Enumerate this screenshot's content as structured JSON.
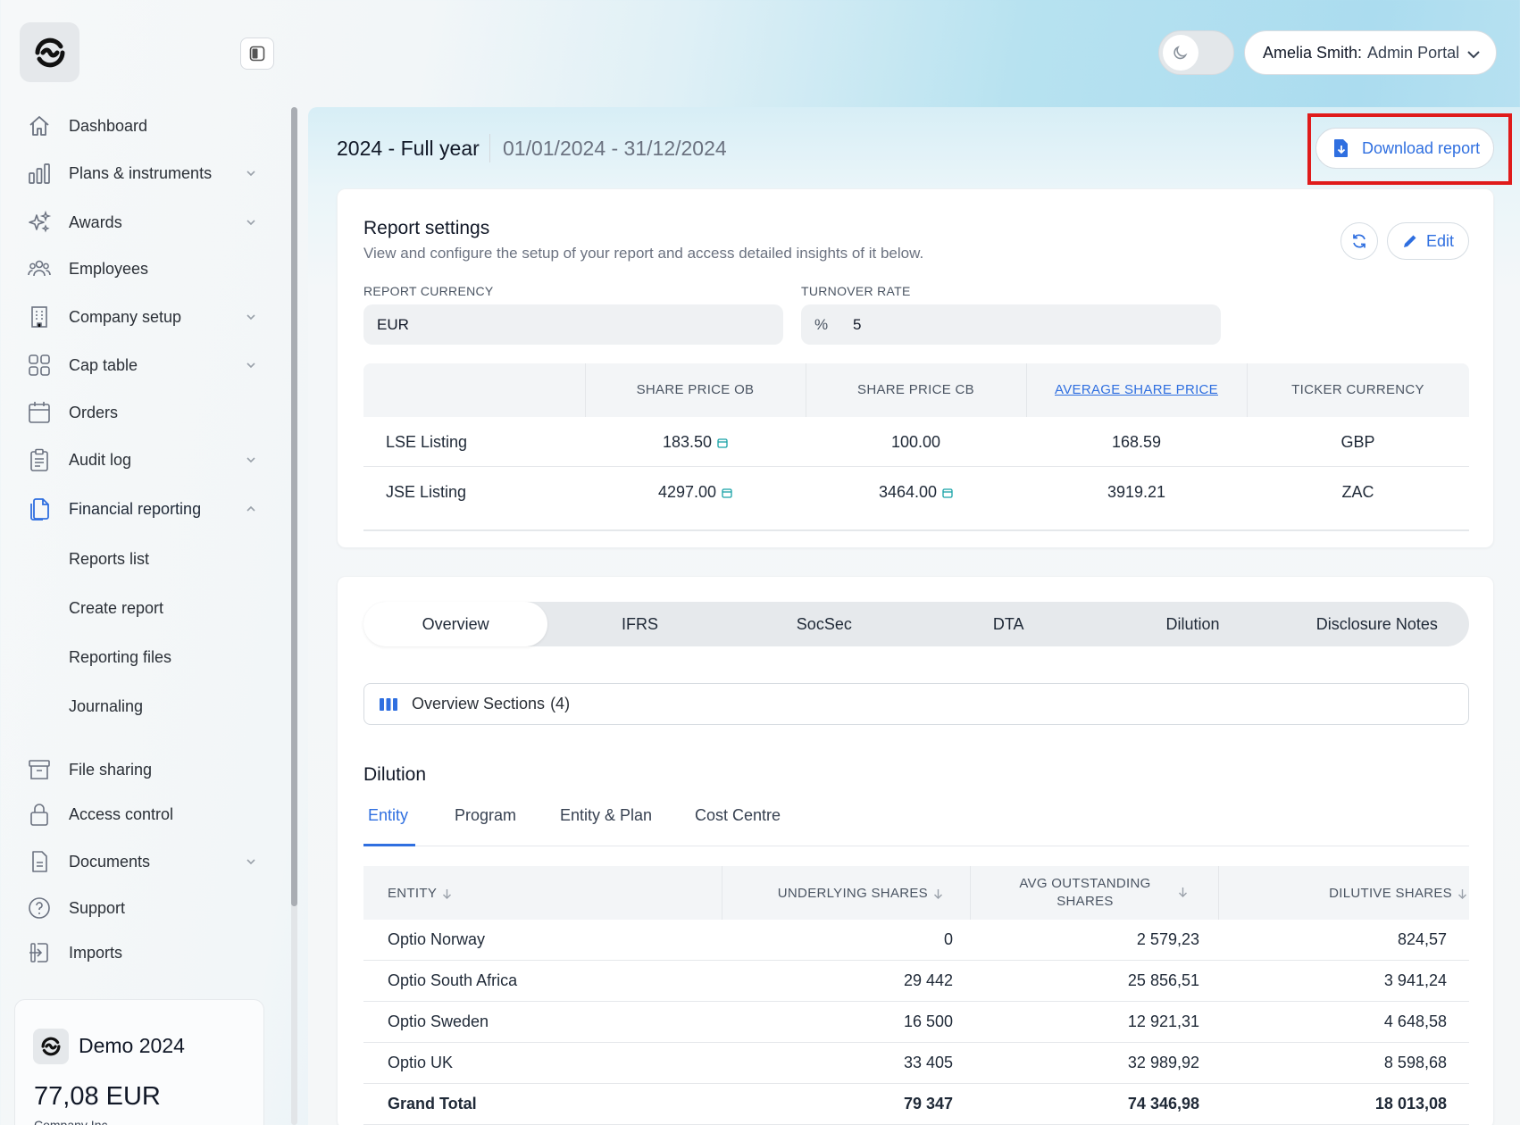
{
  "sidebar": {
    "items": [
      {
        "label": "Dashboard",
        "icon": "home-icon"
      },
      {
        "label": "Plans & instruments",
        "icon": "bar-chart-icon",
        "expandable": true
      },
      {
        "label": "Awards",
        "icon": "sparkles-icon",
        "expandable": true
      },
      {
        "label": "Employees",
        "icon": "users-icon"
      },
      {
        "label": "Company setup",
        "icon": "building-icon",
        "expandable": true
      },
      {
        "label": "Cap table",
        "icon": "grid-icon",
        "expandable": true
      },
      {
        "label": "Orders",
        "icon": "calendar-icon"
      },
      {
        "label": "Audit log",
        "icon": "clipboard-icon",
        "expandable": true
      },
      {
        "label": "Financial reporting",
        "icon": "files-icon",
        "expandable": true,
        "expanded": true,
        "active": true
      },
      {
        "label": "File sharing",
        "icon": "archive-icon"
      },
      {
        "label": "Access control",
        "icon": "lock-icon"
      },
      {
        "label": "Documents",
        "icon": "document-icon",
        "expandable": true
      },
      {
        "label": "Support",
        "icon": "help-icon"
      },
      {
        "label": "Imports",
        "icon": "import-icon"
      }
    ],
    "sub_items": [
      "Reports list",
      "Create report",
      "Reporting files",
      "Journaling"
    ],
    "company_card": {
      "name": "Demo 2024",
      "price": "77,08 EUR",
      "company": "Company Inc"
    }
  },
  "header": {
    "theme_toggle_icon": "moon-icon",
    "user_name": "Amelia Smith:",
    "user_role": "Admin Portal"
  },
  "report": {
    "title": "2024 - Full year",
    "range": "01/01/2024 - 31/12/2024",
    "download_label": "Download report"
  },
  "settings": {
    "title": "Report settings",
    "subtitle": "View and configure the setup of your report and access detailed insights of it below.",
    "edit_label": "Edit",
    "currency_label": "REPORT CURRENCY",
    "currency_value": "EUR",
    "turnover_label": "TURNOVER RATE",
    "turnover_prefix": "%",
    "turnover_value": "5",
    "columns": [
      "",
      "SHARE PRICE OB",
      "SHARE PRICE CB",
      "AVERAGE SHARE PRICE",
      "TICKER CURRENCY"
    ],
    "rows": [
      {
        "name": "LSE Listing",
        "ob": "183.50",
        "ob_cal": true,
        "cb": "100.00",
        "cb_cal": false,
        "avg": "168.59",
        "cur": "GBP"
      },
      {
        "name": "JSE Listing",
        "ob": "4297.00",
        "ob_cal": true,
        "cb": "3464.00",
        "cb_cal": true,
        "avg": "3919.21",
        "cur": "ZAC"
      }
    ]
  },
  "tabs": [
    "Overview",
    "IFRS",
    "SocSec",
    "DTA",
    "Dilution",
    "Disclosure Notes"
  ],
  "active_tab": "Overview",
  "sections_label": "Overview Sections",
  "sections_count": "(4)",
  "dilution": {
    "title": "Dilution",
    "subtabs": [
      "Entity",
      "Program",
      "Entity & Plan",
      "Cost Centre"
    ],
    "active_subtab": "Entity",
    "columns": [
      "ENTITY",
      "UNDERLYING SHARES",
      "AVG OUTSTANDING",
      "SHARES",
      "DILUTIVE SHARES"
    ],
    "rows": [
      {
        "entity": "Optio Norway",
        "underlying": "0",
        "avg": "2 579,23",
        "dilutive": "824,57"
      },
      {
        "entity": "Optio South Africa",
        "underlying": "29 442",
        "avg": "25 856,51",
        "dilutive": "3 941,24"
      },
      {
        "entity": "Optio Sweden",
        "underlying": "16 500",
        "avg": "12 921,31",
        "dilutive": "4 648,58"
      },
      {
        "entity": "Optio UK",
        "underlying": "33 405",
        "avg": "32 989,92",
        "dilutive": "8 598,68"
      }
    ],
    "total": {
      "entity": "Grand Total",
      "underlying": "79 347",
      "avg": "74 346,98",
      "dilutive": "18 013,08"
    }
  },
  "colors": {
    "accent": "#2f6fe0",
    "highlight": "#e01b1b",
    "calendar": "#17a2a6"
  }
}
